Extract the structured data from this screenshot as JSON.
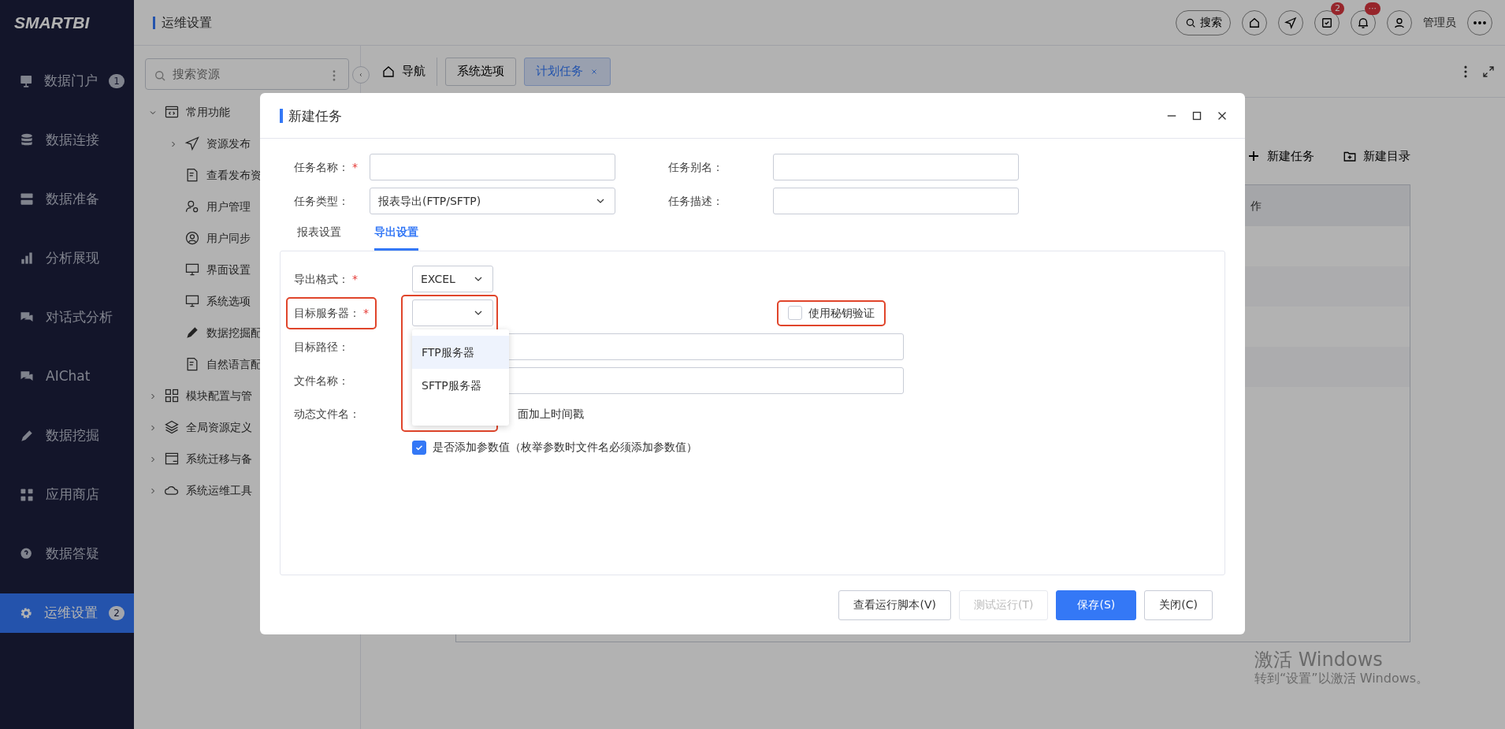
{
  "logo": "SMARTBI",
  "sidebar": {
    "items": [
      {
        "label": "数据门户",
        "badge": "1",
        "selected": false
      },
      {
        "label": "数据连接",
        "selected": false
      },
      {
        "label": "数据准备",
        "selected": false
      },
      {
        "label": "分析展现",
        "selected": false
      },
      {
        "label": "对话式分析",
        "selected": false
      },
      {
        "label": "AIChat",
        "selected": false
      },
      {
        "label": "数据挖掘",
        "selected": false
      },
      {
        "label": "应用商店",
        "selected": false
      },
      {
        "label": "数据答疑",
        "selected": false
      },
      {
        "label": "运维设置",
        "badge": "2",
        "selected": true
      }
    ]
  },
  "header": {
    "title": "运维设置",
    "search_label": "搜索",
    "task_badge": "2",
    "notice_badge": "···",
    "user": "管理员"
  },
  "resource_panel": {
    "search_placeholder": "搜索资源",
    "tree": [
      {
        "label": "常用功能",
        "expanded": true,
        "children": [
          {
            "label": "资源发布",
            "expanded": false
          },
          {
            "label": "查看发布资"
          },
          {
            "label": "用户管理"
          },
          {
            "label": "用户同步"
          },
          {
            "label": "界面设置"
          },
          {
            "label": "系统选项"
          },
          {
            "label": "数据挖掘配"
          },
          {
            "label": "自然语言配"
          }
        ]
      },
      {
        "label": "模块配置与管",
        "expanded": false
      },
      {
        "label": "全局资源定义",
        "expanded": false
      },
      {
        "label": "系统迁移与备",
        "expanded": false
      },
      {
        "label": "系统运维工具",
        "expanded": false
      }
    ]
  },
  "tabs": [
    {
      "label": "导航",
      "kind": "home",
      "selected": false
    },
    {
      "label": "系统选项",
      "kind": "tab",
      "selected": false
    },
    {
      "label": "计划任务",
      "kind": "tab",
      "selected": true,
      "closable": true
    }
  ],
  "toolbar": [
    "新建任务",
    "新建目录"
  ],
  "table": {
    "columns": [
      "作"
    ]
  },
  "dialog": {
    "title": "新建任务",
    "fields": [
      {
        "label": "任务名称：",
        "mark": "*",
        "kind": "input"
      },
      {
        "label": "任务别名：",
        "kind": "input"
      },
      {
        "label": "任务类型：",
        "kind": "select",
        "value": "报表导出(FTP/SFTP)"
      },
      {
        "label": "任务描述：",
        "kind": "input"
      }
    ],
    "tabs": [
      {
        "label": "报表设置",
        "selected": false
      },
      {
        "label": "导出设置",
        "selected": true
      }
    ],
    "export": {
      "format": {
        "label": "导出格式：",
        "mark": "*",
        "value": "EXCEL"
      },
      "server": {
        "label": "目标服务器：",
        "mark": "*",
        "highlighted": true,
        "expanded": true,
        "options": [
          {
            "label": "FTP服务器",
            "hovered": true
          },
          {
            "label": "SFTP服务器",
            "hovered": false
          }
        ]
      },
      "key_auth": {
        "label": "使用秘钥验证",
        "checked": false,
        "highlighted": true
      },
      "path": {
        "label": "目标路径："
      },
      "filename": {
        "label": "文件名称："
      },
      "dynamic": {
        "label": "动态文件名：",
        "timestamp_text": "面加上时间戳",
        "param": {
          "label": "是否添加参数值（枚举参数时文件名必须添加参数值）",
          "checked": true
        }
      }
    },
    "buttons": [
      {
        "label": "查看运行脚本(V)",
        "kind": "default",
        "disabled": false
      },
      {
        "label": "测试运行(T)",
        "kind": "default",
        "disabled": true
      },
      {
        "label": "保存(S)",
        "kind": "primary",
        "disabled": false
      },
      {
        "label": "关闭(C)",
        "kind": "default",
        "disabled": false
      }
    ]
  },
  "os_notice": {
    "title": "激活 Windows",
    "text": "转到“设置”以激活 Windows。"
  }
}
